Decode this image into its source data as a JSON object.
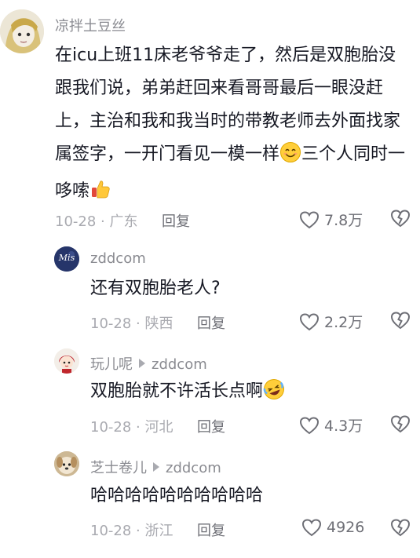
{
  "comments": [
    {
      "username": "凉拌土豆丝",
      "text": "在icu上班11床老爷爷走了，然后是双胞胎没跟我们说，弟弟赶回来看哥哥最后一眼没赶上，主治和我和我当时的带教老师去外面找家属签字，一开门看见一模一样",
      "text_tail": "三个人同时一哆嗦",
      "date": "10-28",
      "location": "广东",
      "reply_label": "回复",
      "likes": "7.8万",
      "emoji_1": "smiling-face",
      "emoji_2": "thumbs-up"
    },
    {
      "username": "zddcom",
      "avatar_text": "Mis",
      "text": "还有双胞胎老人?",
      "date": "10-28",
      "location": "陕西",
      "reply_label": "回复",
      "likes": "2.2万"
    },
    {
      "username": "玩儿呢",
      "reply_to": "zddcom",
      "text": "双胞胎就不许活长点啊",
      "date": "10-28",
      "location": "河北",
      "reply_label": "回复",
      "likes": "4.3万",
      "emoji": "rolling-laughing-face"
    },
    {
      "username": "芝士卷儿",
      "reply_to": "zddcom",
      "text": "哈哈哈哈哈哈哈哈哈哈",
      "date": "10-28",
      "location": "浙江",
      "reply_label": "回复",
      "likes": "4926"
    }
  ],
  "separator": "·",
  "colors": {
    "text": "#161823",
    "muted": "#8a8b91",
    "meta": "#a9aab0"
  }
}
